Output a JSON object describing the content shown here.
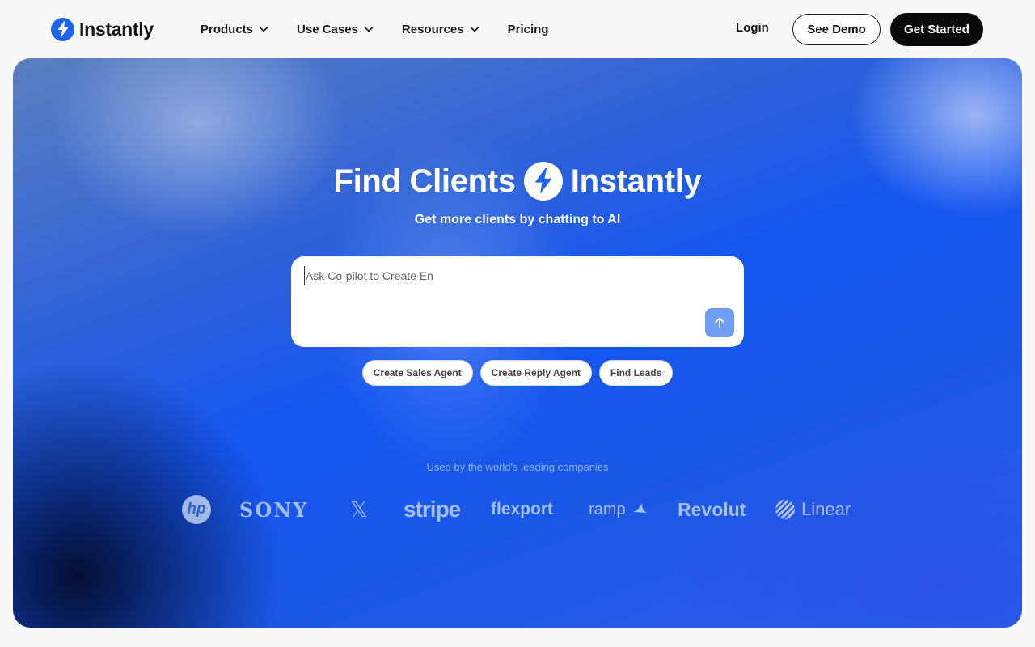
{
  "brand": {
    "name": "Instantly"
  },
  "nav": {
    "menu": [
      {
        "label": "Products",
        "has_dropdown": true
      },
      {
        "label": "Use Cases",
        "has_dropdown": true
      },
      {
        "label": "Resources",
        "has_dropdown": true
      },
      {
        "label": "Pricing",
        "has_dropdown": false
      }
    ],
    "login": "Login",
    "demo": "See Demo",
    "start": "Get Started"
  },
  "hero": {
    "title_left": "Find Clients",
    "title_right": "Instantly",
    "subtitle": "Get more clients by chatting to AI",
    "prompt": {
      "placeholder": "Ask Co-pilot to Create En",
      "value": ""
    },
    "chips": [
      "Create Sales Agent",
      "Create Reply Agent",
      "Find Leads"
    ],
    "used_by": "Used by the world's leading companies",
    "logos": {
      "hp": "hp",
      "sony": "SONY",
      "x": "𝕏",
      "stripe": "stripe",
      "flexport": "flexport",
      "ramp": "ramp",
      "revolut": "Revolut",
      "linear": "Linear"
    }
  },
  "colors": {
    "accent": "#1e63f1",
    "send_button": "#6f9df4",
    "dark_button": "#0a0a0a"
  }
}
